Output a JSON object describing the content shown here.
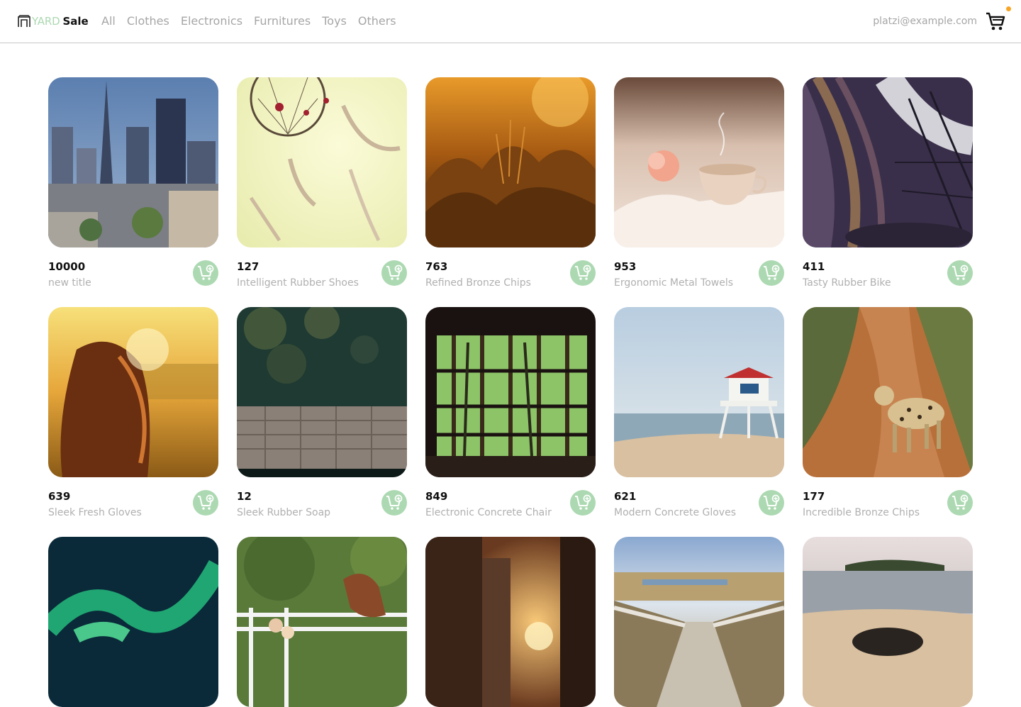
{
  "brand": {
    "word1": "YARD",
    "word2": "Sale"
  },
  "nav": {
    "links": [
      "All",
      "Clothes",
      "Electronics",
      "Furnitures",
      "Toys",
      "Others"
    ],
    "user_email": "platzi@example.com",
    "cart_badge_color": "#f7a523"
  },
  "colors": {
    "accent": "#acd9b2",
    "muted_text": "#a6a6a6"
  },
  "products": [
    {
      "price": "10000",
      "title": "new title",
      "image": "city-skyline-photo"
    },
    {
      "price": "127",
      "title": "Intelligent Rubber Shoes",
      "image": "dreamcatcher-photo"
    },
    {
      "price": "763",
      "title": "Refined Bronze Chips",
      "image": "sunset-grass-photo"
    },
    {
      "price": "953",
      "title": "Ergonomic Metal Towels",
      "image": "teacup-book-photo"
    },
    {
      "price": "411",
      "title": "Tasty Rubber Bike",
      "image": "library-shelves-photo"
    },
    {
      "price": "639",
      "title": "Sleek Fresh Gloves",
      "image": "girl-sunset-field-photo"
    },
    {
      "price": "12",
      "title": "Sleek Rubber Soap",
      "image": "aerial-pier-photo"
    },
    {
      "price": "849",
      "title": "Electronic Concrete Chair",
      "image": "window-forest-photo"
    },
    {
      "price": "621",
      "title": "Modern Concrete Gloves",
      "image": "lifeguard-tower-photo"
    },
    {
      "price": "177",
      "title": "Incredible Bronze Chips",
      "image": "leopard-dirt-road-photo"
    },
    {
      "price": "",
      "title": "",
      "image": "northern-lights-photo"
    },
    {
      "price": "",
      "title": "",
      "image": "children-horse-photo"
    },
    {
      "price": "",
      "title": "",
      "image": "city-street-sunset-photo"
    },
    {
      "price": "",
      "title": "",
      "image": "boardwalk-dunes-photo"
    },
    {
      "price": "",
      "title": "",
      "image": "rocky-beach-photo"
    }
  ]
}
